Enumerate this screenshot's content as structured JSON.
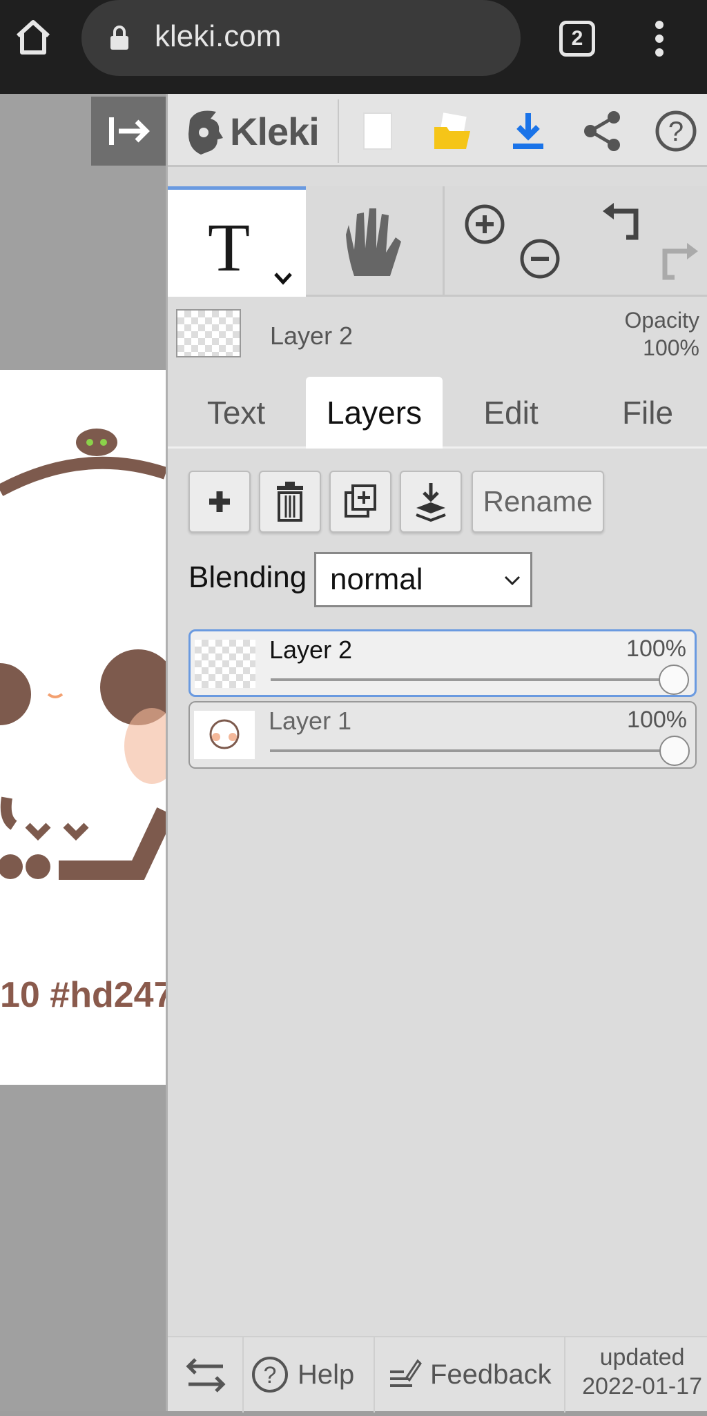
{
  "browser": {
    "url": "kleki.com",
    "tab_count": "2"
  },
  "canvas": {
    "caption": "10 #hd247"
  },
  "toolbar": {
    "logo_text": "Kleki"
  },
  "current_layer": {
    "name": "Layer 2",
    "opacity_label": "Opacity",
    "opacity_value": "100%"
  },
  "tabs": [
    {
      "label": "Text",
      "active": false
    },
    {
      "label": "Layers",
      "active": true
    },
    {
      "label": "Edit",
      "active": false
    },
    {
      "label": "File",
      "active": false
    }
  ],
  "layer_actions": {
    "rename_label": "Rename"
  },
  "blending": {
    "label": "Blending",
    "value": "normal"
  },
  "layers": [
    {
      "name": "Layer 2",
      "opacity": "100%",
      "opacity_fraction": 1.0,
      "selected": true
    },
    {
      "name": "Layer 1",
      "opacity": "100%",
      "opacity_fraction": 1.0,
      "selected": false
    }
  ],
  "footer": {
    "help_label": "Help",
    "feedback_label": "Feedback",
    "updated_label": "updated",
    "updated_date": "2022-01-17"
  },
  "colors": {
    "accent_blue": "#6a9ae0",
    "download_blue": "#1a73e8",
    "folder_yellow": "#f5c518",
    "canvas_brown": "#7d5a4d"
  },
  "icons": [
    "home-icon",
    "lock-icon",
    "menu-icon",
    "collapse-panel-icon",
    "kleki-logo-icon",
    "new-image-icon",
    "open-folder-icon",
    "download-icon",
    "share-icon",
    "help-icon",
    "text-tool-icon",
    "hand-tool-icon",
    "zoom-in-icon",
    "zoom-out-icon",
    "undo-icon",
    "redo-icon",
    "add-layer-icon",
    "delete-layer-icon",
    "duplicate-layer-icon",
    "merge-down-icon",
    "swap-icon",
    "feedback-icon"
  ]
}
